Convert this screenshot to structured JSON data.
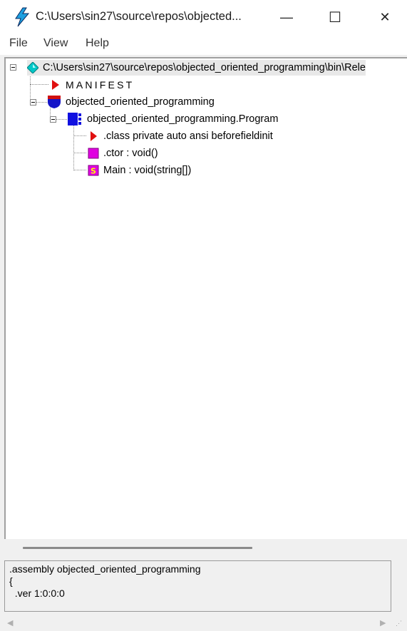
{
  "window": {
    "title": "C:\\Users\\sin27\\source\\repos\\objected...",
    "minimize_glyph": "—",
    "maximize_glyph": "☐",
    "close_glyph": "✕"
  },
  "menu": {
    "file": "File",
    "view": "View",
    "help": "Help"
  },
  "tree": {
    "root": "C:\\Users\\sin27\\source\\repos\\objected_oriented_programming\\bin\\Rele",
    "manifest": "MANIFEST",
    "namespace": "objected_oriented_programming",
    "class_name": "objected_oriented_programming.Program",
    "class_info": ".class private auto ansi beforefieldinit",
    "ctor": ".ctor : void()",
    "main": "Main : void(string[])"
  },
  "detail": {
    "line1": ".assembly objected_oriented_programming",
    "line2": "{",
    "line3": "  .ver 1:0:0:0"
  },
  "icons": {
    "app": "lightning-icon",
    "root": "assembly-diamond-icon",
    "manifest": "manifest-arrow-icon",
    "namespace": "namespace-shield-icon",
    "class": "class-icon",
    "class_info": "class-info-arrow-icon",
    "ctor": "method-icon",
    "main": "static-method-icon"
  },
  "colors": {
    "diamond": "#00c8c8",
    "red_arrow": "#e01010",
    "class_blue": "#1010e0",
    "method_magenta": "#e000e0"
  }
}
